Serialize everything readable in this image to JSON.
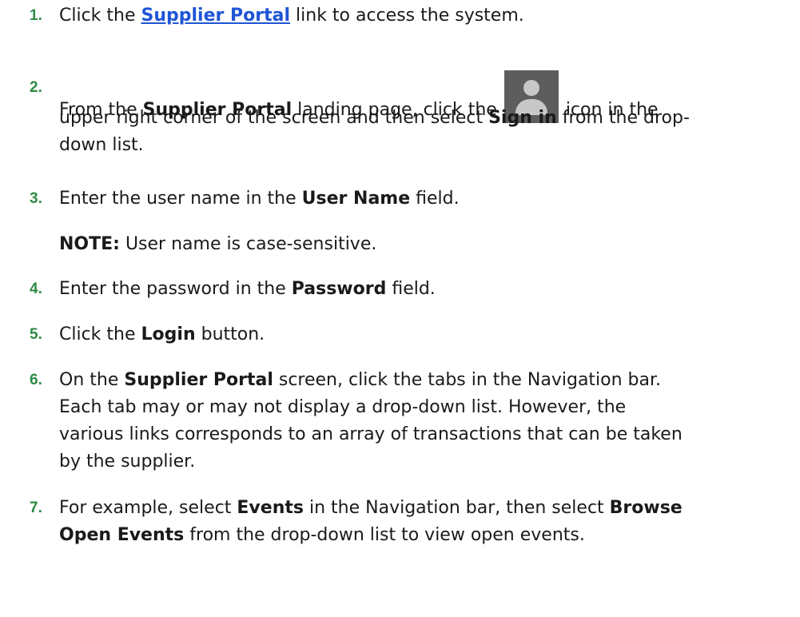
{
  "steps": [
    {
      "number": "1.",
      "pre": "Click the ",
      "link": "Supplier Portal",
      "post": " link to access the system."
    },
    {
      "number": "2.",
      "line1_pre": "From the ",
      "line1_bold": "Supplier Portal",
      "line1_mid": " landing page, click the ",
      "icon": "user-avatar-icon",
      "line1_post": " icon in the",
      "line2_pre": "upper right corner of the screen and then select ",
      "line2_bold": "Sign in",
      "line2_post": " from the drop-",
      "line3": "down list."
    },
    {
      "number": "3.",
      "pre": "Enter the user name in the ",
      "bold": "User Name",
      "post": " field.",
      "note_label": "NOTE:",
      "note_text": " User name is case-sensitive."
    },
    {
      "number": "4.",
      "pre": "Enter the password in the ",
      "bold": "Password",
      "post": " field."
    },
    {
      "number": "5.",
      "pre": "Click the ",
      "bold": "Login",
      "post": " button."
    },
    {
      "number": "6.",
      "line1_pre": "On the ",
      "line1_bold": "Supplier Portal",
      "line1_post": " screen, click the tabs in the Navigation bar.",
      "line2": "Each tab may or may not display a drop-down list. However, the",
      "line3": "various links corresponds to an array of transactions that can be taken",
      "line4": "by the supplier."
    },
    {
      "number": "7.",
      "line1_pre": "For example, select ",
      "line1_bold1": "Events",
      "line1_mid": " in the Navigation bar, then select ",
      "line1_bold2": "Browse",
      "line2_bold": "Open Events",
      "line2_post": " from the drop-down list to view open events."
    }
  ]
}
